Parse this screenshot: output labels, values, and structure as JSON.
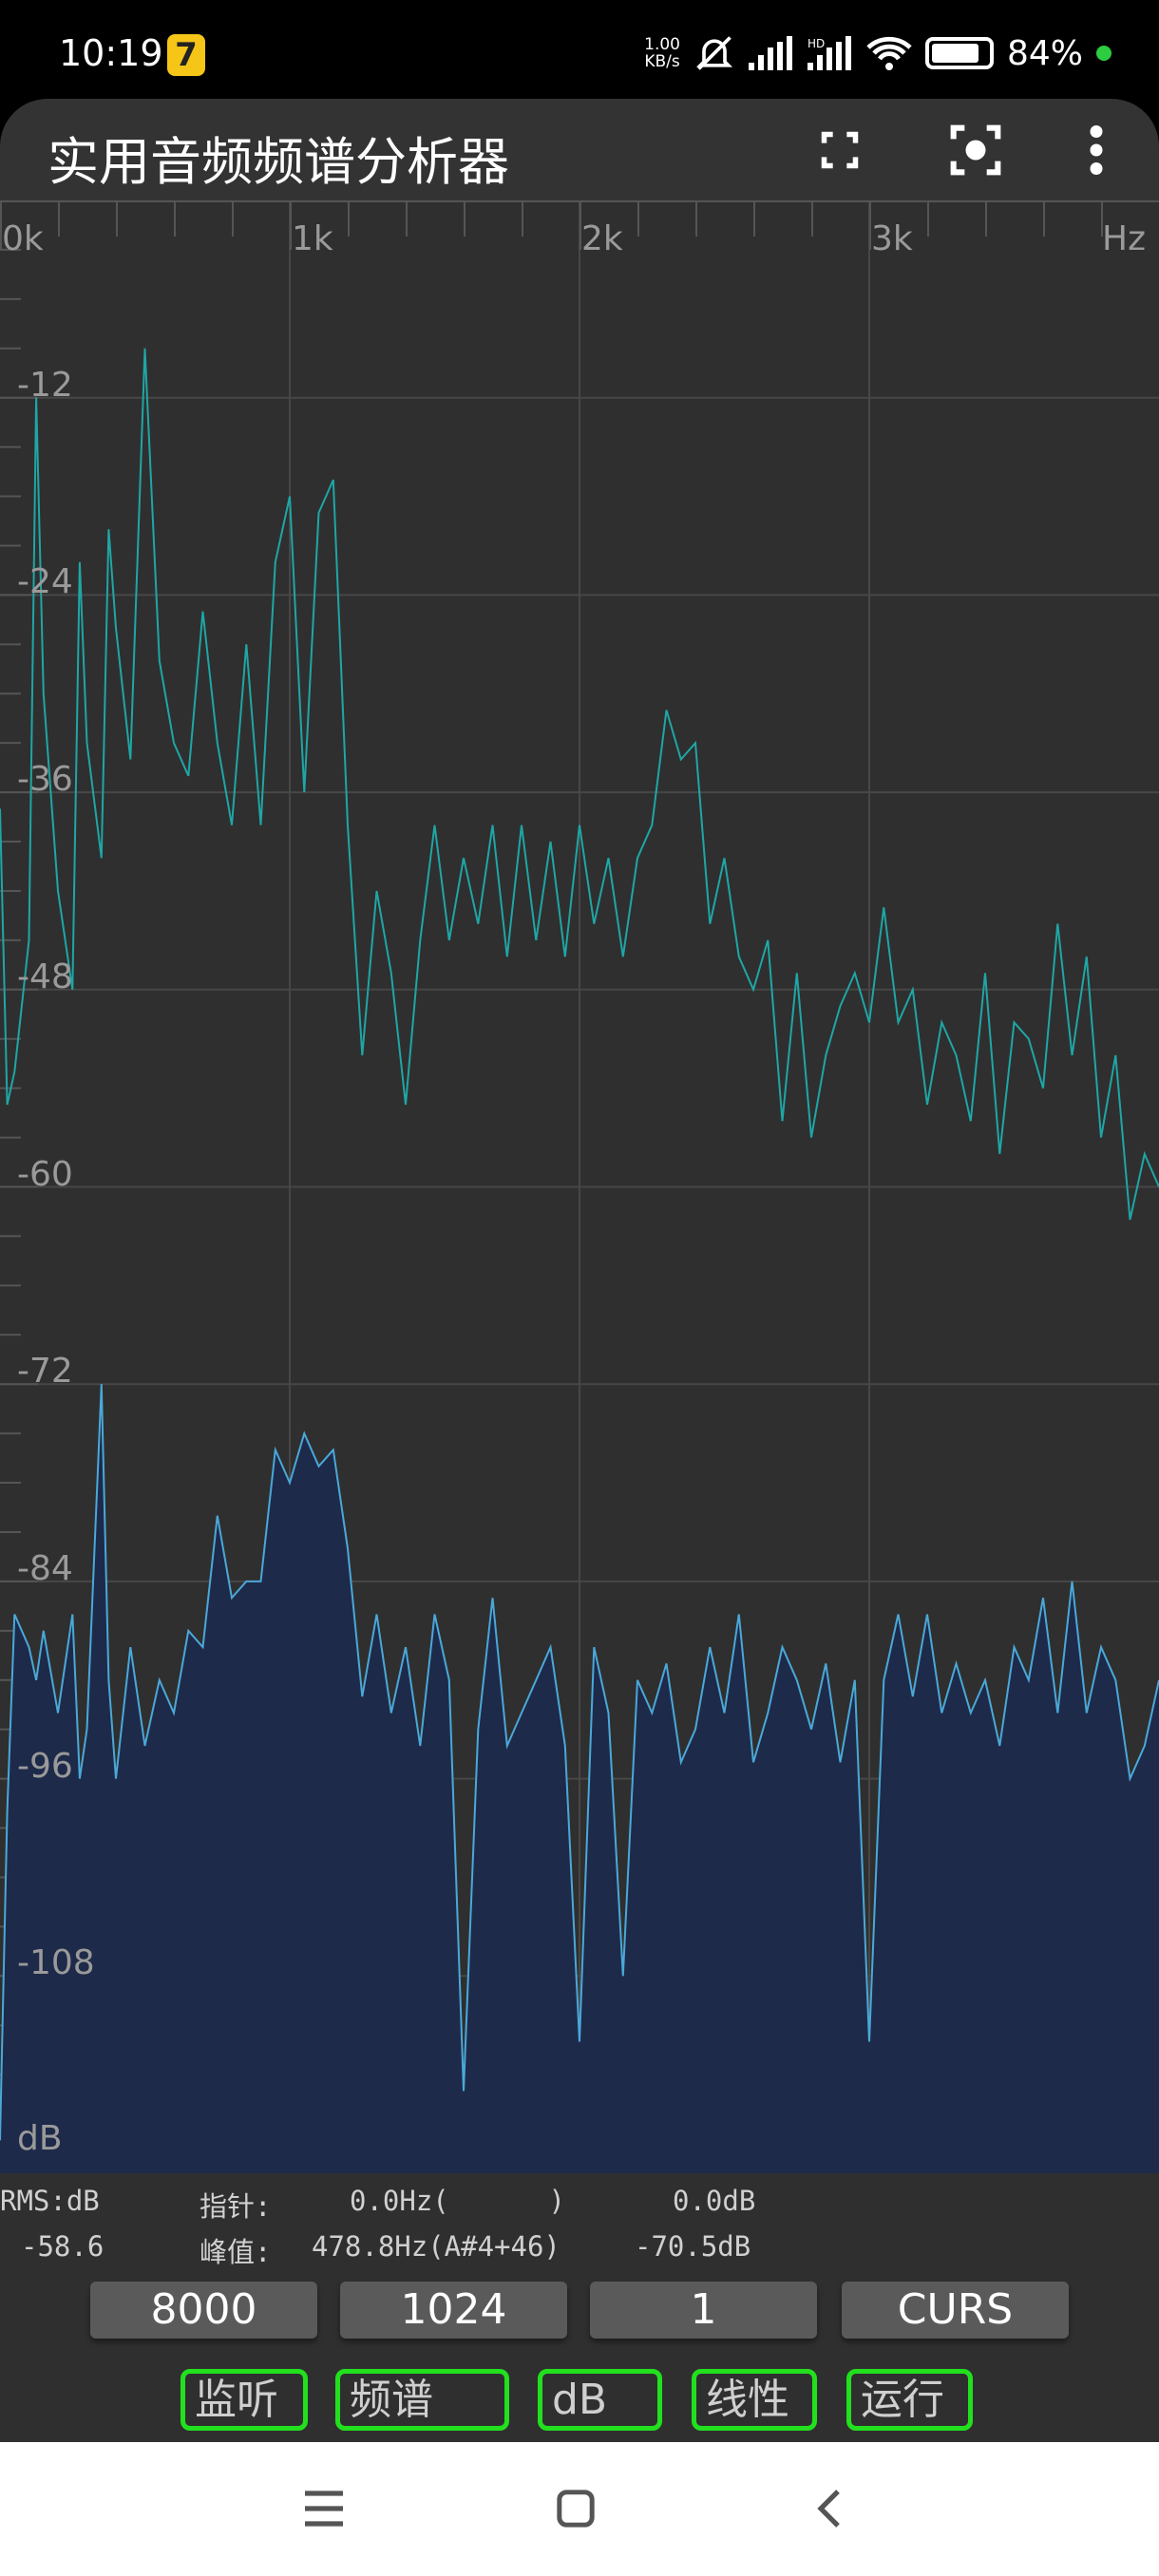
{
  "status_bar": {
    "time": "10:19",
    "app_icon": "7",
    "net_speed": "1.00",
    "net_unit": "KB/s",
    "battery": "84%",
    "battery_level": 84,
    "icons": [
      "mute-bell-icon",
      "signal-icon",
      "hd-signal-icon",
      "wifi-icon",
      "battery-icon"
    ]
  },
  "app_bar": {
    "title": "实用音频频谱分析器",
    "icons": [
      "fullscreen-icon",
      "capture-icon",
      "more-vert-icon"
    ]
  },
  "colors": {
    "peak_line": "#1fa6a6",
    "spectrum_line": "#4aa8d8",
    "spectrum_fill": "#1e2a4a",
    "toggle_border": "#22e01e"
  },
  "chart_data": {
    "type": "area",
    "x_unit_label": "Hz",
    "y_unit_label": "dB",
    "xlim": [
      0,
      4000
    ],
    "ylim": [
      -120,
      0
    ],
    "x_ticks": [
      {
        "v": 0,
        "label": "0k"
      },
      {
        "v": 1000,
        "label": "1k"
      },
      {
        "v": 2000,
        "label": "2k"
      },
      {
        "v": 3000,
        "label": "3k"
      }
    ],
    "y_ticks": [
      -12,
      -24,
      -36,
      -48,
      -60,
      -72,
      -84,
      -96,
      -108
    ],
    "grid": true,
    "x": [
      0,
      25,
      50,
      100,
      125,
      150,
      200,
      250,
      275,
      300,
      350,
      375,
      400,
      450,
      500,
      550,
      600,
      650,
      700,
      750,
      800,
      850,
      900,
      950,
      1000,
      1050,
      1100,
      1150,
      1200,
      1250,
      1300,
      1350,
      1400,
      1450,
      1500,
      1550,
      1600,
      1650,
      1700,
      1750,
      1800,
      1850,
      1900,
      1950,
      2000,
      2050,
      2100,
      2150,
      2200,
      2250,
      2300,
      2350,
      2400,
      2450,
      2500,
      2550,
      2600,
      2650,
      2700,
      2750,
      2800,
      2850,
      2900,
      2950,
      3000,
      3050,
      3100,
      3150,
      3200,
      3250,
      3300,
      3350,
      3400,
      3450,
      3500,
      3550,
      3600,
      3650,
      3700,
      3750,
      3800,
      3850,
      3900,
      3950,
      4000
    ],
    "series": [
      {
        "role": "peak-hold",
        "values": [
          -37,
          -55,
          -53,
          -45,
          -12,
          -30,
          -42,
          -48,
          -22,
          -33,
          -40,
          -20,
          -26,
          -34,
          -9,
          -28,
          -33,
          -35,
          -25,
          -33,
          -38,
          -27,
          -38,
          -22,
          -18,
          -36,
          -19,
          -17,
          -38,
          -52,
          -42,
          -47,
          -55,
          -45,
          -38,
          -45,
          -40,
          -44,
          -38,
          -46,
          -38,
          -45,
          -39,
          -46,
          -38,
          -44,
          -40,
          -46,
          -40,
          -38,
          -31,
          -34,
          -33,
          -44,
          -40,
          -46,
          -48,
          -45,
          -56,
          -47,
          -57,
          -52,
          -49,
          -47,
          -50,
          -43,
          -50,
          -48,
          -55,
          -50,
          -52,
          -56,
          -47,
          -58,
          -50,
          -51,
          -54,
          -44,
          -52,
          -46,
          -57,
          -52,
          -62,
          -58,
          -60
        ]
      },
      {
        "role": "current",
        "values": [
          -118,
          -98,
          -86,
          -88,
          -90,
          -87,
          -92,
          -86,
          -96,
          -93,
          -72,
          -90,
          -96,
          -88,
          -94,
          -90,
          -92,
          -87,
          -88,
          -80,
          -85,
          -84,
          -84,
          -76,
          -78,
          -75,
          -77,
          -76,
          -82,
          -91,
          -86,
          -92,
          -88,
          -94,
          -86,
          -90,
          -115,
          -93,
          -85,
          -94,
          -92,
          -90,
          -88,
          -94,
          -112,
          -88,
          -92,
          -108,
          -90,
          -92,
          -89,
          -95,
          -93,
          -88,
          -92,
          -86,
          -95,
          -92,
          -88,
          -90,
          -93,
          -89,
          -95,
          -90,
          -112,
          -90,
          -86,
          -91,
          -86,
          -92,
          -89,
          -92,
          -90,
          -94,
          -88,
          -90,
          -85,
          -92,
          -84,
          -92,
          -88,
          -90,
          -96,
          -94,
          -90
        ]
      }
    ]
  },
  "readout": {
    "rms_label": "RMS:dB",
    "rms_value": "-58.6",
    "cursor_label": "指针:",
    "cursor_freq": "0.0Hz(      )",
    "cursor_db": "0.0dB",
    "peak_label": "峰值:",
    "peak_freq": "478.8Hz(A#4+46)",
    "peak_db": "-70.5dB"
  },
  "param_buttons": [
    "8000",
    "1024",
    "1",
    "CURS"
  ],
  "toggle_buttons": [
    "监听",
    "频谱",
    "dB",
    "线性",
    "运行"
  ]
}
